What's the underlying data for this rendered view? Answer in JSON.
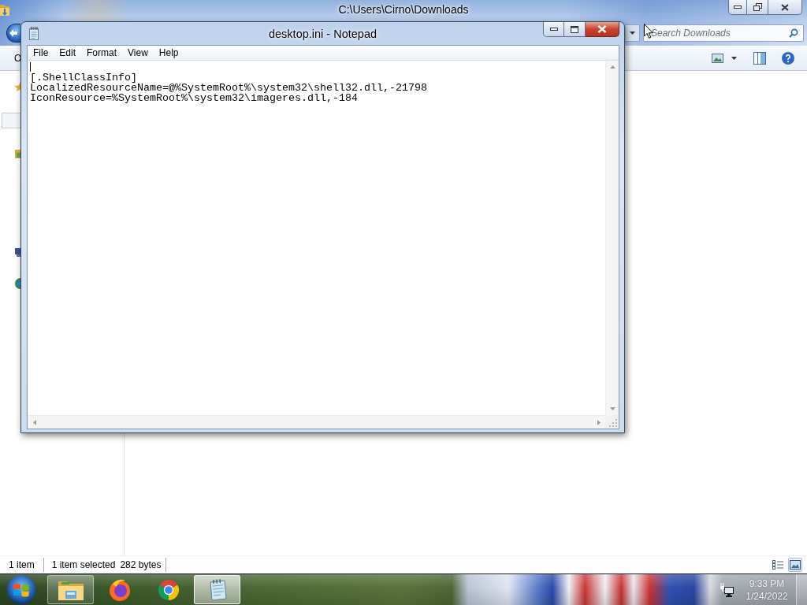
{
  "explorer": {
    "title": "C:\\Users\\Cirno\\Downloads",
    "search": {
      "placeholder": "Search Downloads"
    },
    "toolbar": {
      "first_button": "O"
    },
    "status_bar": {
      "item_count": "1 item",
      "selection": "1 item selected",
      "size": "282 bytes"
    },
    "views": [
      {
        "kind": "details",
        "selected": false
      },
      {
        "kind": "large-icons",
        "selected": true
      }
    ]
  },
  "notepad": {
    "title": "desktop.ini - Notepad",
    "menu": [
      "File",
      "Edit",
      "Format",
      "View",
      "Help"
    ],
    "lines": [
      "[.ShellClassInfo]",
      "LocalizedResourceName=@%SystemRoot%\\system32\\shell32.dll,-21798",
      "IconResource=%SystemRoot%\\system32\\imageres.dll,-184"
    ]
  },
  "taskbar": {
    "buttons": [
      {
        "kind": "explorer",
        "running": true,
        "selected": false
      },
      {
        "kind": "firefox",
        "running": false,
        "selected": false
      },
      {
        "kind": "chrome",
        "running": false,
        "selected": false
      },
      {
        "kind": "notepad",
        "running": true,
        "selected": true
      }
    ],
    "clock": {
      "time": "9:33 PM",
      "date": "1/24/2022"
    }
  }
}
